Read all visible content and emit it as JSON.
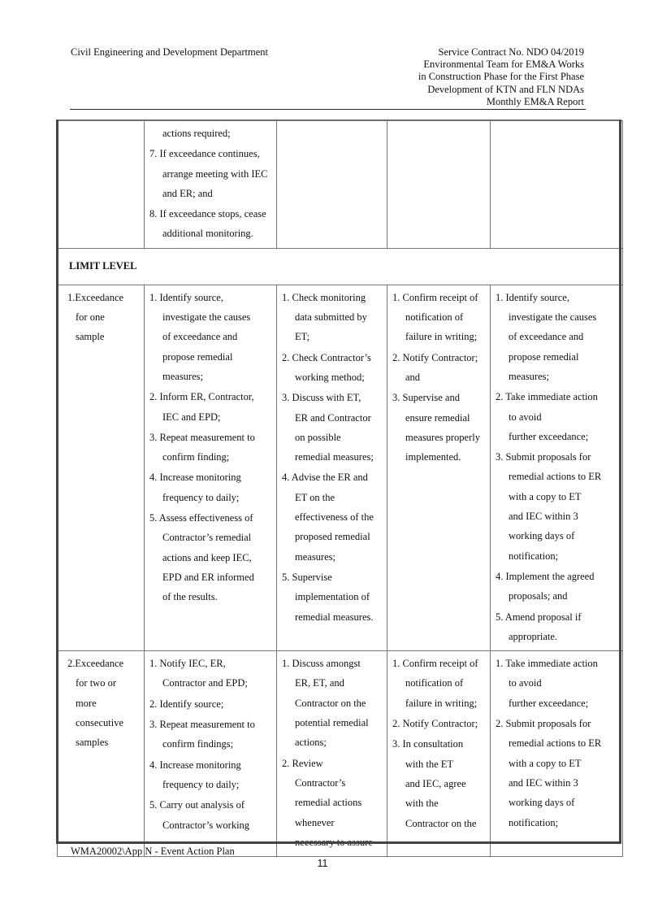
{
  "header": {
    "left": "Civil Engineering and Development Department",
    "right_lines": [
      "Service Contract No. NDO 04/2019",
      "Environmental Team for EM&A Works",
      "in Construction Phase for the First Phase",
      "Development of KTN and FLN NDAs",
      "Monthly EM&A Report"
    ]
  },
  "table": {
    "continuation_row": {
      "event": [],
      "et_items": [
        {
          "lines": [
            "actions required;"
          ],
          "continued": true
        },
        {
          "lines": [
            "7. If exceedance continues,",
            "arrange meeting with IEC",
            "and ER; and"
          ]
        },
        {
          "lines": [
            "8. If exceedance stops, cease",
            "additional monitoring."
          ]
        }
      ],
      "iec_items": [],
      "er_items": [],
      "contractor_items": []
    },
    "level_label": "LIMIT LEVEL",
    "rows": [
      {
        "event_lines": [
          "1.Exceedance",
          "for one",
          "sample"
        ],
        "et_items": [
          {
            "lines": [
              "1. Identify source,",
              "investigate the causes",
              "of exceedance and",
              "propose remedial",
              "measures;"
            ]
          },
          {
            "lines": [
              "2. Inform ER, Contractor,",
              "IEC and EPD;"
            ]
          },
          {
            "lines": [
              "3. Repeat measurement to",
              "confirm finding;"
            ]
          },
          {
            "lines": [
              "4. Increase monitoring",
              "frequency to daily;"
            ]
          },
          {
            "lines": [
              "5. Assess effectiveness of",
              "Contractor’s remedial",
              "actions and keep IEC,",
              "EPD and ER informed",
              "of the results."
            ]
          }
        ],
        "iec_items": [
          {
            "lines": [
              "1. Check monitoring",
              "data submitted by",
              "ET;"
            ]
          },
          {
            "lines": [
              "2. Check Contractor’s",
              "working method;"
            ]
          },
          {
            "lines": [
              "3. Discuss with ET,",
              "ER and Contractor",
              "on possible",
              "remedial measures;"
            ]
          },
          {
            "lines": [
              "4. Advise the ER and",
              "ET on the",
              "effectiveness of the",
              "proposed remedial",
              "measures;"
            ]
          },
          {
            "lines": [
              "5. Supervise",
              "implementation of",
              "remedial measures."
            ]
          }
        ],
        "er_items": [
          {
            "lines": [
              "1. Confirm receipt of",
              "notification of",
              "failure in writing;"
            ]
          },
          {
            "lines": [
              "2. Notify Contractor;",
              "and"
            ]
          },
          {
            "lines": [
              "3. Supervise and",
              "ensure remedial",
              "measures properly",
              "implemented."
            ]
          }
        ],
        "contractor_items": [
          {
            "lines": [
              "1. Identify source,",
              "investigate the causes",
              "of exceedance and",
              "propose remedial",
              "measures;"
            ]
          },
          {
            "lines": [
              "2. Take immediate action",
              "to avoid",
              "further exceedance;"
            ]
          },
          {
            "lines": [
              "3. Submit proposals for",
              "remedial actions to ER",
              "with a copy to ET",
              "and IEC within 3",
              "working days of",
              "notification;"
            ]
          },
          {
            "lines": [
              "4. Implement the agreed",
              "proposals; and"
            ]
          },
          {
            "lines": [
              "5. Amend proposal if",
              "appropriate."
            ]
          }
        ]
      },
      {
        "event_lines": [
          "2.Exceedance",
          "for two or",
          "more",
          "consecutive",
          "samples"
        ],
        "et_items": [
          {
            "lines": [
              "1. Notify IEC, ER,",
              "Contractor and EPD;"
            ]
          },
          {
            "lines": [
              "2. Identify source;"
            ]
          },
          {
            "lines": [
              "3. Repeat measurement to",
              "confirm findings;"
            ]
          },
          {
            "lines": [
              "4. Increase monitoring",
              "frequency to daily;"
            ]
          },
          {
            "lines": [
              "5. Carry out analysis of",
              "Contractor’s working"
            ]
          }
        ],
        "iec_items": [
          {
            "lines": [
              "1. Discuss amongst",
              "ER, ET, and",
              "Contractor on the",
              "potential remedial",
              "actions;"
            ]
          },
          {
            "lines": [
              "2. Review",
              "Contractor’s",
              "remedial actions",
              "whenever",
              "necessary to assure"
            ]
          }
        ],
        "er_items": [
          {
            "lines": [
              "1. Confirm receipt of",
              "notification of",
              "failure in writing;"
            ]
          },
          {
            "lines": [
              "2. Notify Contractor;"
            ]
          },
          {
            "lines": [
              "3. In consultation",
              "with the ET",
              "and IEC, agree",
              "with the",
              "Contractor on the"
            ]
          }
        ],
        "contractor_items": [
          {
            "lines": [
              "1. Take immediate action",
              "to avoid",
              "further exceedance;"
            ]
          },
          {
            "lines": [
              "2. Submit proposals for",
              "remedial actions to ER",
              "with a copy to ET",
              "and IEC within 3",
              "working days of",
              "notification;"
            ]
          }
        ]
      }
    ]
  },
  "footer": {
    "reference": "WMA20002\\App N - Event Action Plan",
    "page_number": "11"
  }
}
